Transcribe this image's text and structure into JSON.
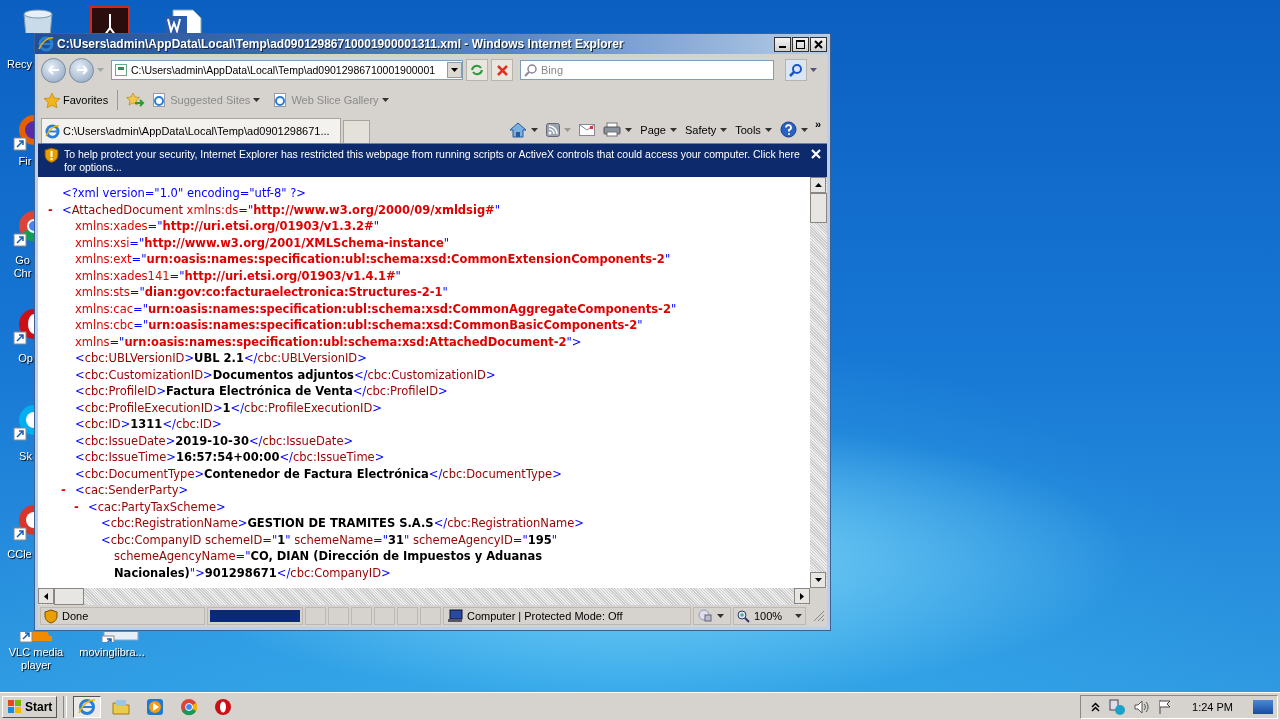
{
  "desktop_icons": [
    {
      "kind": "recycle-bin",
      "label": "Recy"
    },
    {
      "kind": "pdf"
    },
    {
      "kind": "word"
    },
    {
      "kind": "firefox",
      "label": "Fir"
    },
    {
      "kind": "chrome",
      "label": "Go Chr"
    },
    {
      "kind": "opera",
      "label": "Op"
    },
    {
      "kind": "skype",
      "label": "Sk"
    },
    {
      "kind": "ccleaner",
      "label": "CCle"
    },
    {
      "kind": "vlc",
      "label": "VLC media player"
    },
    {
      "kind": "file",
      "label": "movinglibra..."
    }
  ],
  "window": {
    "title": "C:\\Users\\admin\\AppData\\Local\\Temp\\ad09012986710001900001311.xml - Windows Internet Explorer",
    "address": "C:\\Users\\admin\\AppData\\Local\\Temp\\ad09012986710001900001",
    "search": {
      "placeholder": "Bing"
    },
    "favorites_bar": {
      "label": "Favorites",
      "links": [
        {
          "label": "Suggested Sites",
          "disabled": true
        },
        {
          "label": "Web Slice Gallery",
          "disabled": true
        }
      ]
    },
    "tabs": [
      {
        "label": "C:\\Users\\admin\\AppData\\Local\\Temp\\ad0901298671...",
        "selected": true
      }
    ],
    "command_bar": {
      "menus": [
        "Page",
        "Safety",
        "Tools"
      ],
      "more": "»"
    },
    "info_bar": {
      "text": "To help protect your security, Internet Explorer has restricted this webpage from running scripts or ActiveX controls that could access your computer. Click here for options..."
    },
    "xml": [
      {
        "lines": [
          [
            {
              "kind": "markup",
              "text": "<?xml version=\"1.0\" encoding=\"utf-8\" ?>"
            }
          ]
        ]
      },
      {
        "toggle": "-",
        "lines": [
          [
            {
              "kind": "markup",
              "text": "<"
            },
            {
              "kind": "name",
              "text": "AttachedDocument"
            },
            {
              "kind": "nsname",
              "text": " xmlns:ds"
            },
            {
              "kind": "markup",
              "text": "=\""
            },
            {
              "kind": "nsvalue",
              "text": "http://www.w3.org/2000/09/xmldsig#"
            },
            {
              "kind": "markup",
              "text": "\""
            }
          ],
          [
            {
              "kind": "nsname",
              "text": "xmlns:xades"
            },
            {
              "kind": "markup",
              "text": "=\""
            },
            {
              "kind": "nsvalue",
              "text": "http://uri.etsi.org/01903/v1.3.2#"
            },
            {
              "kind": "markup",
              "text": "\""
            }
          ],
          [
            {
              "kind": "nsname",
              "text": "xmlns:xsi"
            },
            {
              "kind": "markup",
              "text": "=\""
            },
            {
              "kind": "nsvalue",
              "text": "http://www.w3.org/2001/XMLSchema-instance"
            },
            {
              "kind": "markup",
              "text": "\""
            }
          ],
          [
            {
              "kind": "nsname",
              "text": "xmlns:ext"
            },
            {
              "kind": "markup",
              "text": "=\""
            },
            {
              "kind": "nsvalue",
              "text": "urn:oasis:names:specification:ubl:schema:xsd:CommonExtensionComponents-2"
            },
            {
              "kind": "markup",
              "text": "\""
            }
          ],
          [
            {
              "kind": "nsname",
              "text": "xmlns:xades141"
            },
            {
              "kind": "markup",
              "text": "=\""
            },
            {
              "kind": "nsvalue",
              "text": "http://uri.etsi.org/01903/v1.4.1#"
            },
            {
              "kind": "markup",
              "text": "\""
            }
          ],
          [
            {
              "kind": "nsname",
              "text": "xmlns:sts"
            },
            {
              "kind": "markup",
              "text": "=\""
            },
            {
              "kind": "nsvalue",
              "text": "dian:gov:co:facturaelectronica:Structures-2-1"
            },
            {
              "kind": "markup",
              "text": "\""
            }
          ],
          [
            {
              "kind": "nsname",
              "text": "xmlns:cac"
            },
            {
              "kind": "markup",
              "text": "=\""
            },
            {
              "kind": "nsvalue",
              "text": "urn:oasis:names:specification:ubl:schema:xsd:CommonAggregateComponents-2"
            },
            {
              "kind": "markup",
              "text": "\""
            }
          ],
          [
            {
              "kind": "nsname",
              "text": "xmlns:cbc"
            },
            {
              "kind": "markup",
              "text": "=\""
            },
            {
              "kind": "nsvalue",
              "text": "urn:oasis:names:specification:ubl:schema:xsd:CommonBasicComponents-2"
            },
            {
              "kind": "markup",
              "text": "\""
            }
          ],
          [
            {
              "kind": "nsname",
              "text": "xmlns"
            },
            {
              "kind": "markup",
              "text": "=\""
            },
            {
              "kind": "nsvalue",
              "text": "urn:oasis:names:specification:ubl:schema:xsd:AttachedDocument-2"
            },
            {
              "kind": "markup",
              "text": "\">"
            }
          ]
        ],
        "children": [
          {
            "lines": [
              [
                {
                  "kind": "markup",
                  "text": "<"
                },
                {
                  "kind": "name",
                  "text": "cbc:UBLVersionID"
                },
                {
                  "kind": "markup",
                  "text": ">"
                },
                {
                  "kind": "text",
                  "text": "UBL 2.1"
                },
                {
                  "kind": "markup",
                  "text": "</"
                },
                {
                  "kind": "name",
                  "text": "cbc:UBLVersionID"
                },
                {
                  "kind": "markup",
                  "text": ">"
                }
              ]
            ]
          },
          {
            "lines": [
              [
                {
                  "kind": "markup",
                  "text": "<"
                },
                {
                  "kind": "name",
                  "text": "cbc:CustomizationID"
                },
                {
                  "kind": "markup",
                  "text": ">"
                },
                {
                  "kind": "text",
                  "text": "Documentos adjuntos"
                },
                {
                  "kind": "markup",
                  "text": "</"
                },
                {
                  "kind": "name",
                  "text": "cbc:CustomizationID"
                },
                {
                  "kind": "markup",
                  "text": ">"
                }
              ]
            ]
          },
          {
            "lines": [
              [
                {
                  "kind": "markup",
                  "text": "<"
                },
                {
                  "kind": "name",
                  "text": "cbc:ProfileID"
                },
                {
                  "kind": "markup",
                  "text": ">"
                },
                {
                  "kind": "text",
                  "text": "Factura Electrónica de Venta"
                },
                {
                  "kind": "markup",
                  "text": "</"
                },
                {
                  "kind": "name",
                  "text": "cbc:ProfileID"
                },
                {
                  "kind": "markup",
                  "text": ">"
                }
              ]
            ]
          },
          {
            "lines": [
              [
                {
                  "kind": "markup",
                  "text": "<"
                },
                {
                  "kind": "name",
                  "text": "cbc:ProfileExecutionID"
                },
                {
                  "kind": "markup",
                  "text": ">"
                },
                {
                  "kind": "text",
                  "text": "1"
                },
                {
                  "kind": "markup",
                  "text": "</"
                },
                {
                  "kind": "name",
                  "text": "cbc:ProfileExecutionID"
                },
                {
                  "kind": "markup",
                  "text": ">"
                }
              ]
            ]
          },
          {
            "lines": [
              [
                {
                  "kind": "markup",
                  "text": "<"
                },
                {
                  "kind": "name",
                  "text": "cbc:ID"
                },
                {
                  "kind": "markup",
                  "text": ">"
                },
                {
                  "kind": "text",
                  "text": "1311"
                },
                {
                  "kind": "markup",
                  "text": "</"
                },
                {
                  "kind": "name",
                  "text": "cbc:ID"
                },
                {
                  "kind": "markup",
                  "text": ">"
                }
              ]
            ]
          },
          {
            "lines": [
              [
                {
                  "kind": "markup",
                  "text": "<"
                },
                {
                  "kind": "name",
                  "text": "cbc:IssueDate"
                },
                {
                  "kind": "markup",
                  "text": ">"
                },
                {
                  "kind": "text",
                  "text": "2019-10-30"
                },
                {
                  "kind": "markup",
                  "text": "</"
                },
                {
                  "kind": "name",
                  "text": "cbc:IssueDate"
                },
                {
                  "kind": "markup",
                  "text": ">"
                }
              ]
            ]
          },
          {
            "lines": [
              [
                {
                  "kind": "markup",
                  "text": "<"
                },
                {
                  "kind": "name",
                  "text": "cbc:IssueTime"
                },
                {
                  "kind": "markup",
                  "text": ">"
                },
                {
                  "kind": "text",
                  "text": "16:57:54+00:00"
                },
                {
                  "kind": "markup",
                  "text": "</"
                },
                {
                  "kind": "name",
                  "text": "cbc:IssueTime"
                },
                {
                  "kind": "markup",
                  "text": ">"
                }
              ]
            ]
          },
          {
            "lines": [
              [
                {
                  "kind": "markup",
                  "text": "<"
                },
                {
                  "kind": "name",
                  "text": "cbc:DocumentType"
                },
                {
                  "kind": "markup",
                  "text": ">"
                },
                {
                  "kind": "text",
                  "text": "Contenedor de Factura Electrónica"
                },
                {
                  "kind": "markup",
                  "text": "</"
                },
                {
                  "kind": "name",
                  "text": "cbc:DocumentType"
                },
                {
                  "kind": "markup",
                  "text": ">"
                }
              ]
            ]
          },
          {
            "toggle": "-",
            "lines": [
              [
                {
                  "kind": "markup",
                  "text": "<"
                },
                {
                  "kind": "name",
                  "text": "cac:SenderParty"
                },
                {
                  "kind": "markup",
                  "text": ">"
                }
              ]
            ],
            "children": [
              {
                "toggle": "-",
                "lines": [
                  [
                    {
                      "kind": "markup",
                      "text": "<"
                    },
                    {
                      "kind": "name",
                      "text": "cac:PartyTaxScheme"
                    },
                    {
                      "kind": "markup",
                      "text": ">"
                    }
                  ]
                ],
                "children": [
                  {
                    "lines": [
                      [
                        {
                          "kind": "markup",
                          "text": "<"
                        },
                        {
                          "kind": "name",
                          "text": "cbc:RegistrationName"
                        },
                        {
                          "kind": "markup",
                          "text": ">"
                        },
                        {
                          "kind": "text",
                          "text": "GESTION DE TRAMITES S.A.S"
                        },
                        {
                          "kind": "markup",
                          "text": "</"
                        },
                        {
                          "kind": "name",
                          "text": "cbc:RegistrationName"
                        },
                        {
                          "kind": "markup",
                          "text": ">"
                        }
                      ]
                    ]
                  },
                  {
                    "lines": [
                      [
                        {
                          "kind": "markup",
                          "text": "<"
                        },
                        {
                          "kind": "name",
                          "text": "cbc:CompanyID schemeID"
                        },
                        {
                          "kind": "markup",
                          "text": "=\""
                        },
                        {
                          "kind": "value",
                          "text": "1"
                        },
                        {
                          "kind": "markup",
                          "text": "\""
                        },
                        {
                          "kind": "name",
                          "text": " schemeName"
                        },
                        {
                          "kind": "markup",
                          "text": "=\""
                        },
                        {
                          "kind": "value",
                          "text": "31"
                        },
                        {
                          "kind": "markup",
                          "text": "\""
                        },
                        {
                          "kind": "name",
                          "text": " schemeAgencyID"
                        },
                        {
                          "kind": "markup",
                          "text": "=\""
                        },
                        {
                          "kind": "value",
                          "text": "195"
                        },
                        {
                          "kind": "markup",
                          "text": "\""
                        }
                      ],
                      [
                        {
                          "kind": "name",
                          "text": "schemeAgencyName"
                        },
                        {
                          "kind": "markup",
                          "text": "=\""
                        },
                        {
                          "kind": "value",
                          "text": "CO, DIAN (Dirección de Impuestos y Aduanas"
                        }
                      ],
                      [
                        {
                          "kind": "value",
                          "text": "Nacionales)"
                        },
                        {
                          "kind": "markup",
                          "text": "\">"
                        },
                        {
                          "kind": "text",
                          "text": "901298671"
                        },
                        {
                          "kind": "markup",
                          "text": "</"
                        },
                        {
                          "kind": "name",
                          "text": "cbc:CompanyID"
                        },
                        {
                          "kind": "markup",
                          "text": ">"
                        }
                      ]
                    ]
                  }
                ]
              }
            ]
          }
        ]
      }
    ],
    "status_bar": {
      "status": "Done",
      "progress": {
        "level": 1
      },
      "zone": "Computer | Protected Mode: Off",
      "zoom": "100%"
    }
  },
  "taskbar": {
    "start": "Start",
    "apps": [
      {
        "kind": "ie",
        "active": true
      },
      {
        "kind": "explorer",
        "active": false
      },
      {
        "kind": "media-player",
        "active": false
      },
      {
        "kind": "chrome",
        "active": false
      },
      {
        "kind": "opera",
        "active": false
      }
    ],
    "clock": "1:24 PM"
  }
}
